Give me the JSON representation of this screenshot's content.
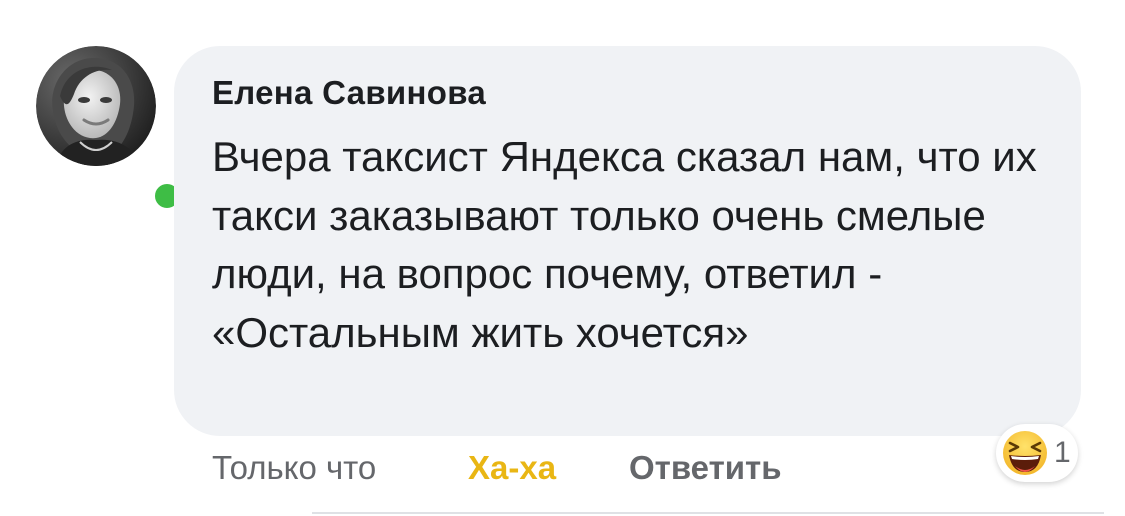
{
  "comment": {
    "author": "Елена Савинова",
    "text": "Вчера таксист Яндекса сказал нам, что их такси заказывают только очень смелые люди, на вопрос почему, ответил - «Остальным жить хочется»",
    "status": "online"
  },
  "actions": {
    "time": "Только что",
    "reaction_label": "Ха-ха",
    "reply_label": "Ответить"
  },
  "reactions": {
    "emoji_icon": "laughing-face-icon",
    "count": "1"
  },
  "colors": {
    "bubble": "#f0f2f5",
    "online": "#3ebd45",
    "haha": "#e9b614",
    "muted_text": "#65676b",
    "text": "#1c1e21"
  }
}
